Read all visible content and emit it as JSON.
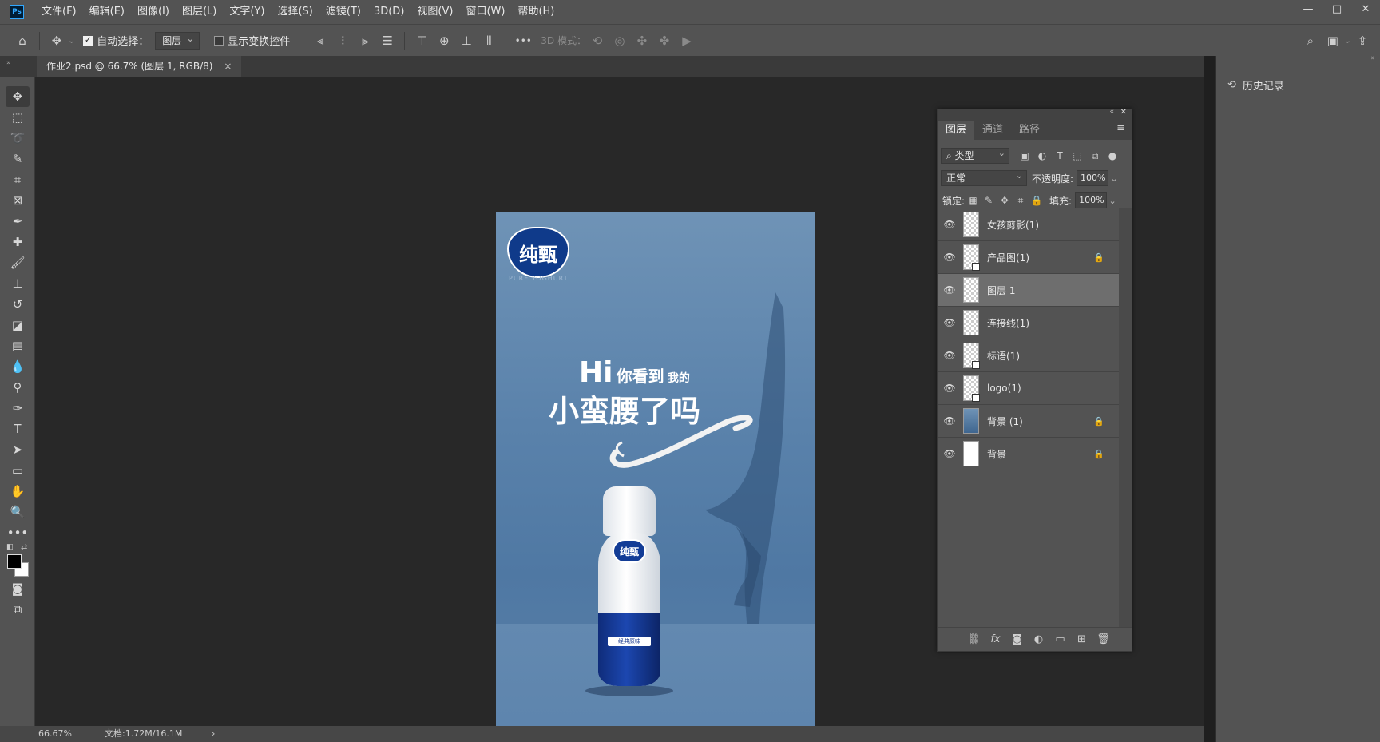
{
  "app": {
    "logo": "Ps"
  },
  "menu": [
    "文件(F)",
    "编辑(E)",
    "图像(I)",
    "图层(L)",
    "文字(Y)",
    "选择(S)",
    "滤镜(T)",
    "3D(D)",
    "视图(V)",
    "窗口(W)",
    "帮助(H)"
  ],
  "window_controls": {
    "minimize": "—",
    "maximize": "□",
    "close": "✕"
  },
  "options": {
    "auto_select_label": "自动选择：",
    "auto_select_checked": true,
    "auto_select_target": "图层",
    "show_transform_label": "显示变换控件",
    "show_transform_checked": false,
    "mode_3d_label": "3D 模式：",
    "more": "•••"
  },
  "document": {
    "tab_title": "作业2.psd @ 66.7% (图层 1, RGB/8)",
    "close": "×"
  },
  "artwork": {
    "brand": "纯甄",
    "brand_sub": "PURE YOGHURT",
    "slogan_hi": "Hi",
    "slogan_mid": "你看到",
    "slogan_small": "我的",
    "slogan_line2": "小蛮腰了吗",
    "bottle_brand": "纯甄",
    "bottle_flavor": "经典原味"
  },
  "status": {
    "zoom": "66.67%",
    "doc": "文档:1.72M/16.1M",
    "arrow": "›"
  },
  "history": {
    "label": "历史记录"
  },
  "layers_panel": {
    "tabs": [
      "图层",
      "通道",
      "路径"
    ],
    "active_tab": 0,
    "filter_kind": "类型",
    "blend_mode": "正常",
    "opacity_label": "不透明度:",
    "opacity": "100%",
    "lock_label": "锁定:",
    "fill_label": "填充:",
    "fill": "100%",
    "layers": [
      {
        "name": "女孩剪影(1)",
        "thumb": "checker",
        "smart": false,
        "locked": false,
        "selected": false
      },
      {
        "name": "产品图(1)",
        "thumb": "checker",
        "smart": true,
        "locked": true,
        "selected": false
      },
      {
        "name": "图层 1",
        "thumb": "checker",
        "smart": false,
        "locked": false,
        "selected": true
      },
      {
        "name": "连接线(1)",
        "thumb": "checker",
        "smart": false,
        "locked": false,
        "selected": false
      },
      {
        "name": "标语(1)",
        "thumb": "checker",
        "smart": true,
        "locked": false,
        "selected": false
      },
      {
        "name": "logo(1)",
        "thumb": "checker",
        "smart": true,
        "locked": false,
        "selected": false
      },
      {
        "name": "背景 (1)",
        "thumb": "photo",
        "smart": false,
        "locked": true,
        "selected": false
      },
      {
        "name": "背景",
        "thumb": "white",
        "smart": false,
        "locked": true,
        "selected": false
      }
    ]
  },
  "colors": {
    "ui_bg": "#535353",
    "canvas_bg": "#282828",
    "accent": "#31a8ff",
    "artwork_blue": "#5a82ab"
  }
}
